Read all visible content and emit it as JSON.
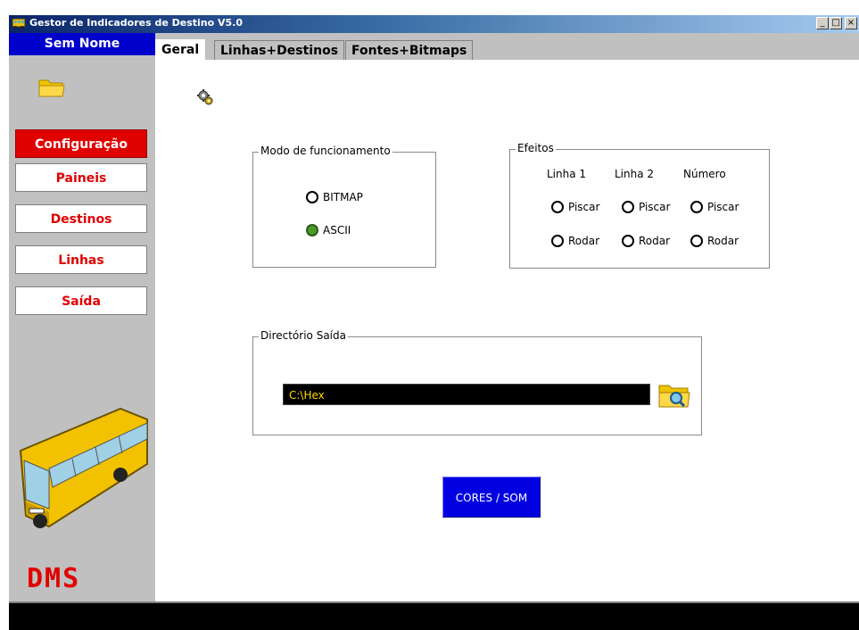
{
  "window": {
    "title": "Gestor de Indicadores de Destino  V5.0",
    "controls": {
      "minimize": "_",
      "maximize": "□",
      "close": "×"
    }
  },
  "sidebar": {
    "project_name": "Sem Nome",
    "items": [
      {
        "label": "Configuração",
        "active": true
      },
      {
        "label": "Paineis",
        "active": false
      },
      {
        "label": "Destinos",
        "active": false
      },
      {
        "label": "Linhas",
        "active": false
      },
      {
        "label": "Saída",
        "active": false
      }
    ],
    "logo_text": "DMS"
  },
  "tabs": [
    {
      "label": "Geral",
      "active": true
    },
    {
      "label": "Linhas+Destinos",
      "active": false
    },
    {
      "label": "Fontes+Bitmaps",
      "active": false
    }
  ],
  "modo": {
    "legend": "Modo de funcionamento",
    "options": [
      {
        "label": "BITMAP",
        "selected": false
      },
      {
        "label": "ASCII",
        "selected": true
      }
    ]
  },
  "efeitos": {
    "legend": "Efeitos",
    "columns": [
      "Linha 1",
      "Linha 2",
      "Número"
    ],
    "row1_label": "Piscar",
    "row2_label": "Rodar"
  },
  "saida": {
    "legend": "Directório Saída",
    "path": "C:\\Hex"
  },
  "cores_button": "CORES / SOM",
  "colors": {
    "accent_red": "#e00000",
    "accent_blue": "#0000e0",
    "path_text": "#ffd700"
  }
}
